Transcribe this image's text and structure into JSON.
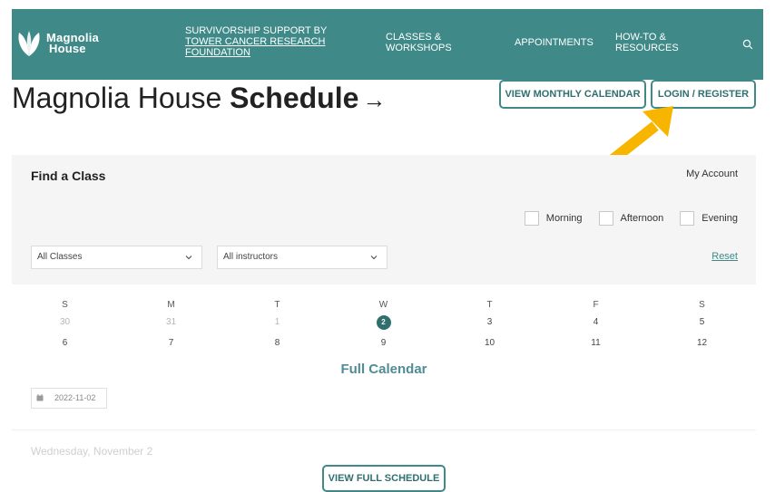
{
  "header": {
    "logo_line1": "Magnolia",
    "logo_line2": "House",
    "survivorship_line1": "SURVIVORSHIP SUPPORT BY",
    "survivorship_line2": "TOWER CANCER RESEARCH",
    "survivorship_line3": "FOUNDATION",
    "nav_classes_line1": "CLASSES &",
    "nav_classes_line2": "WORKSHOPS",
    "nav_appointments": "APPOINTMENTS",
    "nav_howto_line1": "HOW-TO &",
    "nav_howto_line2": "RESOURCES"
  },
  "title": {
    "prefix": "Magnolia House",
    "bold": "Schedule",
    "arrow": "→"
  },
  "buttons": {
    "monthly": "VIEW MONTHLY CALENDAR",
    "login": "LOGIN / REGISTER",
    "full_schedule": "VIEW FULL SCHEDULE"
  },
  "find": {
    "title": "Find a Class",
    "my_account": "My Account",
    "checkboxes": [
      "Morning",
      "Afternoon",
      "Evening"
    ],
    "classes_select": "All Classes",
    "instructors_select": "All instructors",
    "reset": "Reset"
  },
  "calendar": {
    "days": [
      "S",
      "M",
      "T",
      "W",
      "T",
      "F",
      "S"
    ],
    "week1": [
      "30",
      "31",
      "1",
      "2",
      "3",
      "4",
      "5"
    ],
    "week2": [
      "6",
      "7",
      "8",
      "9",
      "10",
      "11",
      "12"
    ],
    "full_calendar": "Full Calendar",
    "date_value": "2022-11-02"
  },
  "listing": {
    "faded_day": "Wednesday, November 2"
  },
  "colors": {
    "teal": "#3f8a88",
    "arrow_yellow": "#f7b500"
  }
}
